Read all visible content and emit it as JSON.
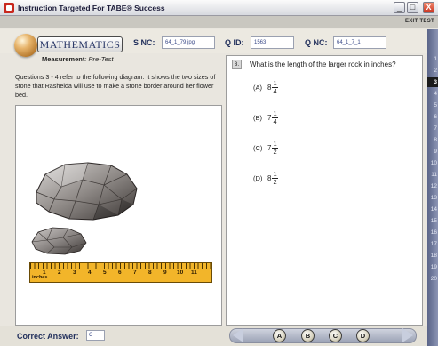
{
  "window": {
    "title": "Instruction Targeted For TABE® Success",
    "controls": [
      "_",
      "□",
      "X"
    ]
  },
  "toolbar": {
    "exit_label": "EXIT TEST"
  },
  "header": {
    "subject": "MATHEMATICS",
    "subtitle_bold": "Measurement",
    "subtitle_rest": ": Pre-Test",
    "snc_label": "S NC:",
    "snc_value": "64_1_79.jpg",
    "qid_label": "Q ID:",
    "qid_value": "1563",
    "qnc_label": "Q NC:",
    "qnc_value": "64_1_7_1"
  },
  "passage": {
    "text": "Questions 3 - 4 refer to the following diagram. It shows the two sizes of stone that Rasheida will use to make a stone border around her flower bed."
  },
  "ruler": {
    "numbers": [
      "1",
      "2",
      "3",
      "4",
      "5",
      "6",
      "7",
      "8",
      "9",
      "10",
      "11"
    ],
    "unit": "inches",
    "color": "#f2b52a"
  },
  "question": {
    "number": "3.",
    "text": "What is the length of the larger rock in inches?",
    "choices": [
      {
        "letter": "(A)",
        "whole": "8",
        "num": "1",
        "den": "4"
      },
      {
        "letter": "(B)",
        "whole": "7",
        "num": "1",
        "den": "4"
      },
      {
        "letter": "(C)",
        "whole": "7",
        "num": "1",
        "den": "2"
      },
      {
        "letter": "(D)",
        "whole": "8",
        "num": "1",
        "den": "2"
      }
    ]
  },
  "sidebar": {
    "items": [
      "1",
      "2",
      "3",
      "4",
      "5",
      "6",
      "7",
      "8",
      "9",
      "10",
      "11",
      "12",
      "13",
      "14",
      "15",
      "16",
      "17",
      "18",
      "19",
      "20"
    ],
    "current": "3"
  },
  "footer": {
    "correct_answer_label": "Correct Answer:",
    "correct_answer_value": "C",
    "answer_buttons": [
      "A",
      "B",
      "C",
      "D"
    ]
  }
}
